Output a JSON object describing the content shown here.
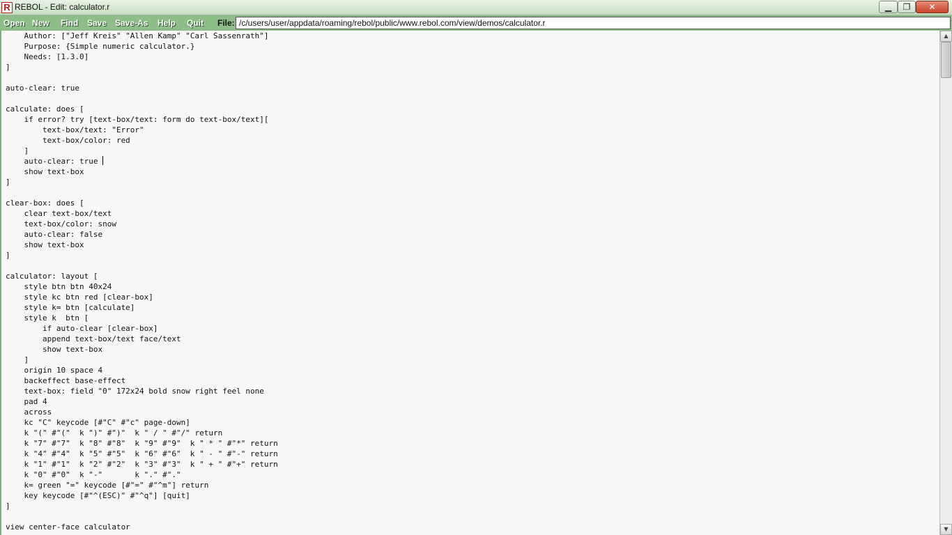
{
  "window": {
    "app_icon_letter": "R",
    "title": "REBOL - Edit: calculator.r",
    "minimize_glyph": "▁",
    "maximize_glyph": "❐",
    "close_glyph": "✕"
  },
  "toolbar": {
    "items": [
      "Open",
      "New",
      "Find",
      "Save",
      "Save-As",
      "Help",
      "Quit"
    ],
    "file_label": "File:",
    "file_path": "/c/users/user/appdata/roaming/rebol/public/www.rebol.com/view/demos/calculator.r"
  },
  "editor": {
    "lines": [
      "    Author: [\"Jeff Kreis\" \"Allen Kamp\" \"Carl Sassenrath\"]",
      "    Purpose: {Simple numeric calculator.}",
      "    Needs: [1.3.0]",
      "]",
      "",
      "auto-clear: true",
      "",
      "calculate: does [",
      "    if error? try [text-box/text: form do text-box/text][",
      "        text-box/text: \"Error\"",
      "        text-box/color: red",
      "    ]",
      "    auto-clear: true",
      "    show text-box",
      "]",
      "",
      "clear-box: does [",
      "    clear text-box/text",
      "    text-box/color: snow",
      "    auto-clear: false",
      "    show text-box",
      "]",
      "",
      "calculator: layout [",
      "    style btn btn 40x24",
      "    style kc btn red [clear-box]",
      "    style k= btn [calculate]",
      "    style k  btn [",
      "        if auto-clear [clear-box]",
      "        append text-box/text face/text",
      "        show text-box",
      "    ]",
      "    origin 10 space 4",
      "    backeffect base-effect",
      "    text-box: field \"0\" 172x24 bold snow right feel none",
      "    pad 4",
      "    across",
      "    kc \"C\" keycode [#\"C\" #\"c\" page-down]",
      "    k \"(\" #\"(\"  k \")\" #\")\"  k \" / \" #\"/\" return",
      "    k \"7\" #\"7\"  k \"8\" #\"8\"  k \"9\" #\"9\"  k \" * \" #\"*\" return",
      "    k \"4\" #\"4\"  k \"5\" #\"5\"  k \"6\" #\"6\"  k \" - \" #\"-\" return",
      "    k \"1\" #\"1\"  k \"2\" #\"2\"  k \"3\" #\"3\"  k \" + \" #\"+\" return",
      "    k \"0\" #\"0\"  k \"-\"       k \".\" #\".\"",
      "    k= green \"=\" keycode [#\"=\" #\"^m\"] return",
      "    key keycode [#\"^(ESC)\" #\"^q\"] [quit]",
      "]",
      "",
      "view center-face calculator"
    ]
  },
  "scrollbar": {
    "up_arrow_glyph": "▲",
    "down_arrow_glyph": "▼"
  }
}
